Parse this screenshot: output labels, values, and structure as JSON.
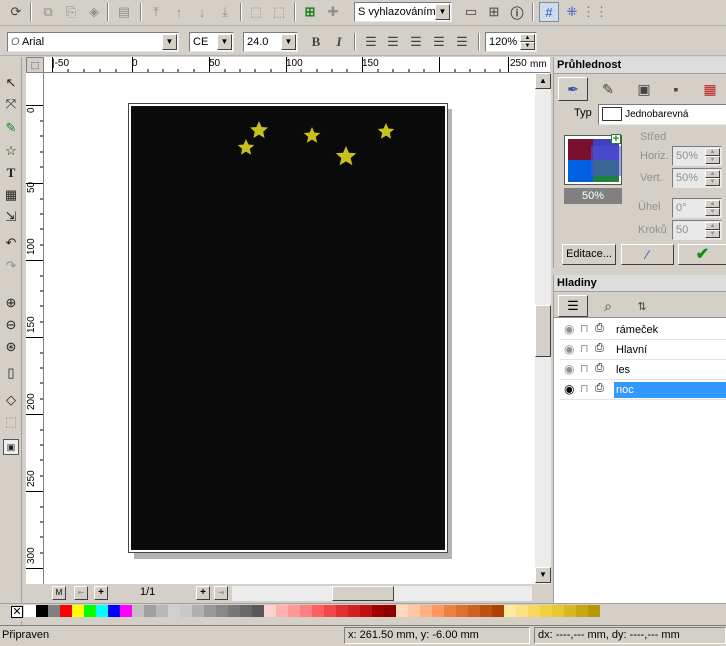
{
  "toolbar": {
    "antialias_label": "S vyhlazováním"
  },
  "format_bar": {
    "font_name": "Arial",
    "encoding": "CE",
    "font_size": "24.0",
    "bold": "B",
    "italic": "I",
    "zoom": "120%"
  },
  "ruler": {
    "top_marks": [
      "|-50",
      "0",
      "50",
      "100",
      "150",
      "250"
    ],
    "left_marks": [
      "0",
      "50",
      "100",
      "150",
      "200",
      "250",
      "300"
    ],
    "unit": "mm"
  },
  "page_nav": {
    "first": "M",
    "page": "1/1"
  },
  "transparency_panel": {
    "title": "Průhlednost",
    "type_label": "Typ",
    "type_value": "Jednobarevná",
    "percent": "50%",
    "center_label": "Střed",
    "horiz_label": "Horiz.",
    "horiz_value": "50%",
    "vert_label": "Vert.",
    "vert_value": "50%",
    "angle_label": "Úhel",
    "angle_value": "0°",
    "steps_label": "Kroků",
    "steps_value": "50",
    "edit_button": "Editace..."
  },
  "layers_panel": {
    "title": "Hladiny",
    "layers": [
      {
        "name": "rámeček",
        "selected": false
      },
      {
        "name": "Hlavní",
        "selected": false
      },
      {
        "name": "les",
        "selected": false
      },
      {
        "name": "noc",
        "selected": true
      }
    ]
  },
  "status": {
    "message": "Připraven",
    "coords": "x: 261.50 mm, y: -6.00 mm",
    "delta": "dx: ----,--- mm, dy: ----,--- mm"
  },
  "colors": {
    "page_fill": "#0a0a0a",
    "star": "#c8c020",
    "selection": "#3399ff",
    "palette": [
      "#ffffff",
      "#000000",
      "#808080",
      "#ff0000",
      "#ffff00",
      "#00ff00",
      "#00ffff",
      "#0000ff",
      "#ff00ff",
      "#c0c0c0",
      "#a0a0a0",
      "#b8b8b8",
      "#d0d0d0",
      "#c8c8c8",
      "#b0b0b0",
      "#989898",
      "#888888",
      "#787878",
      "#686868",
      "#585858",
      "#ffd0d0",
      "#ffb0b0",
      "#ff9898",
      "#ff8080",
      "#ff6060",
      "#f04848",
      "#e03030",
      "#d02020",
      "#c01010",
      "#a00000",
      "#900000",
      "#ffd8c0",
      "#ffc8a0",
      "#ffb080",
      "#ff9860",
      "#f08040",
      "#e07030",
      "#d06020",
      "#c05010",
      "#b04000",
      "#ffe8a0",
      "#ffe080",
      "#f8d860",
      "#f0d040",
      "#e8c830",
      "#d8b820",
      "#c8a810",
      "#b89800"
    ]
  }
}
